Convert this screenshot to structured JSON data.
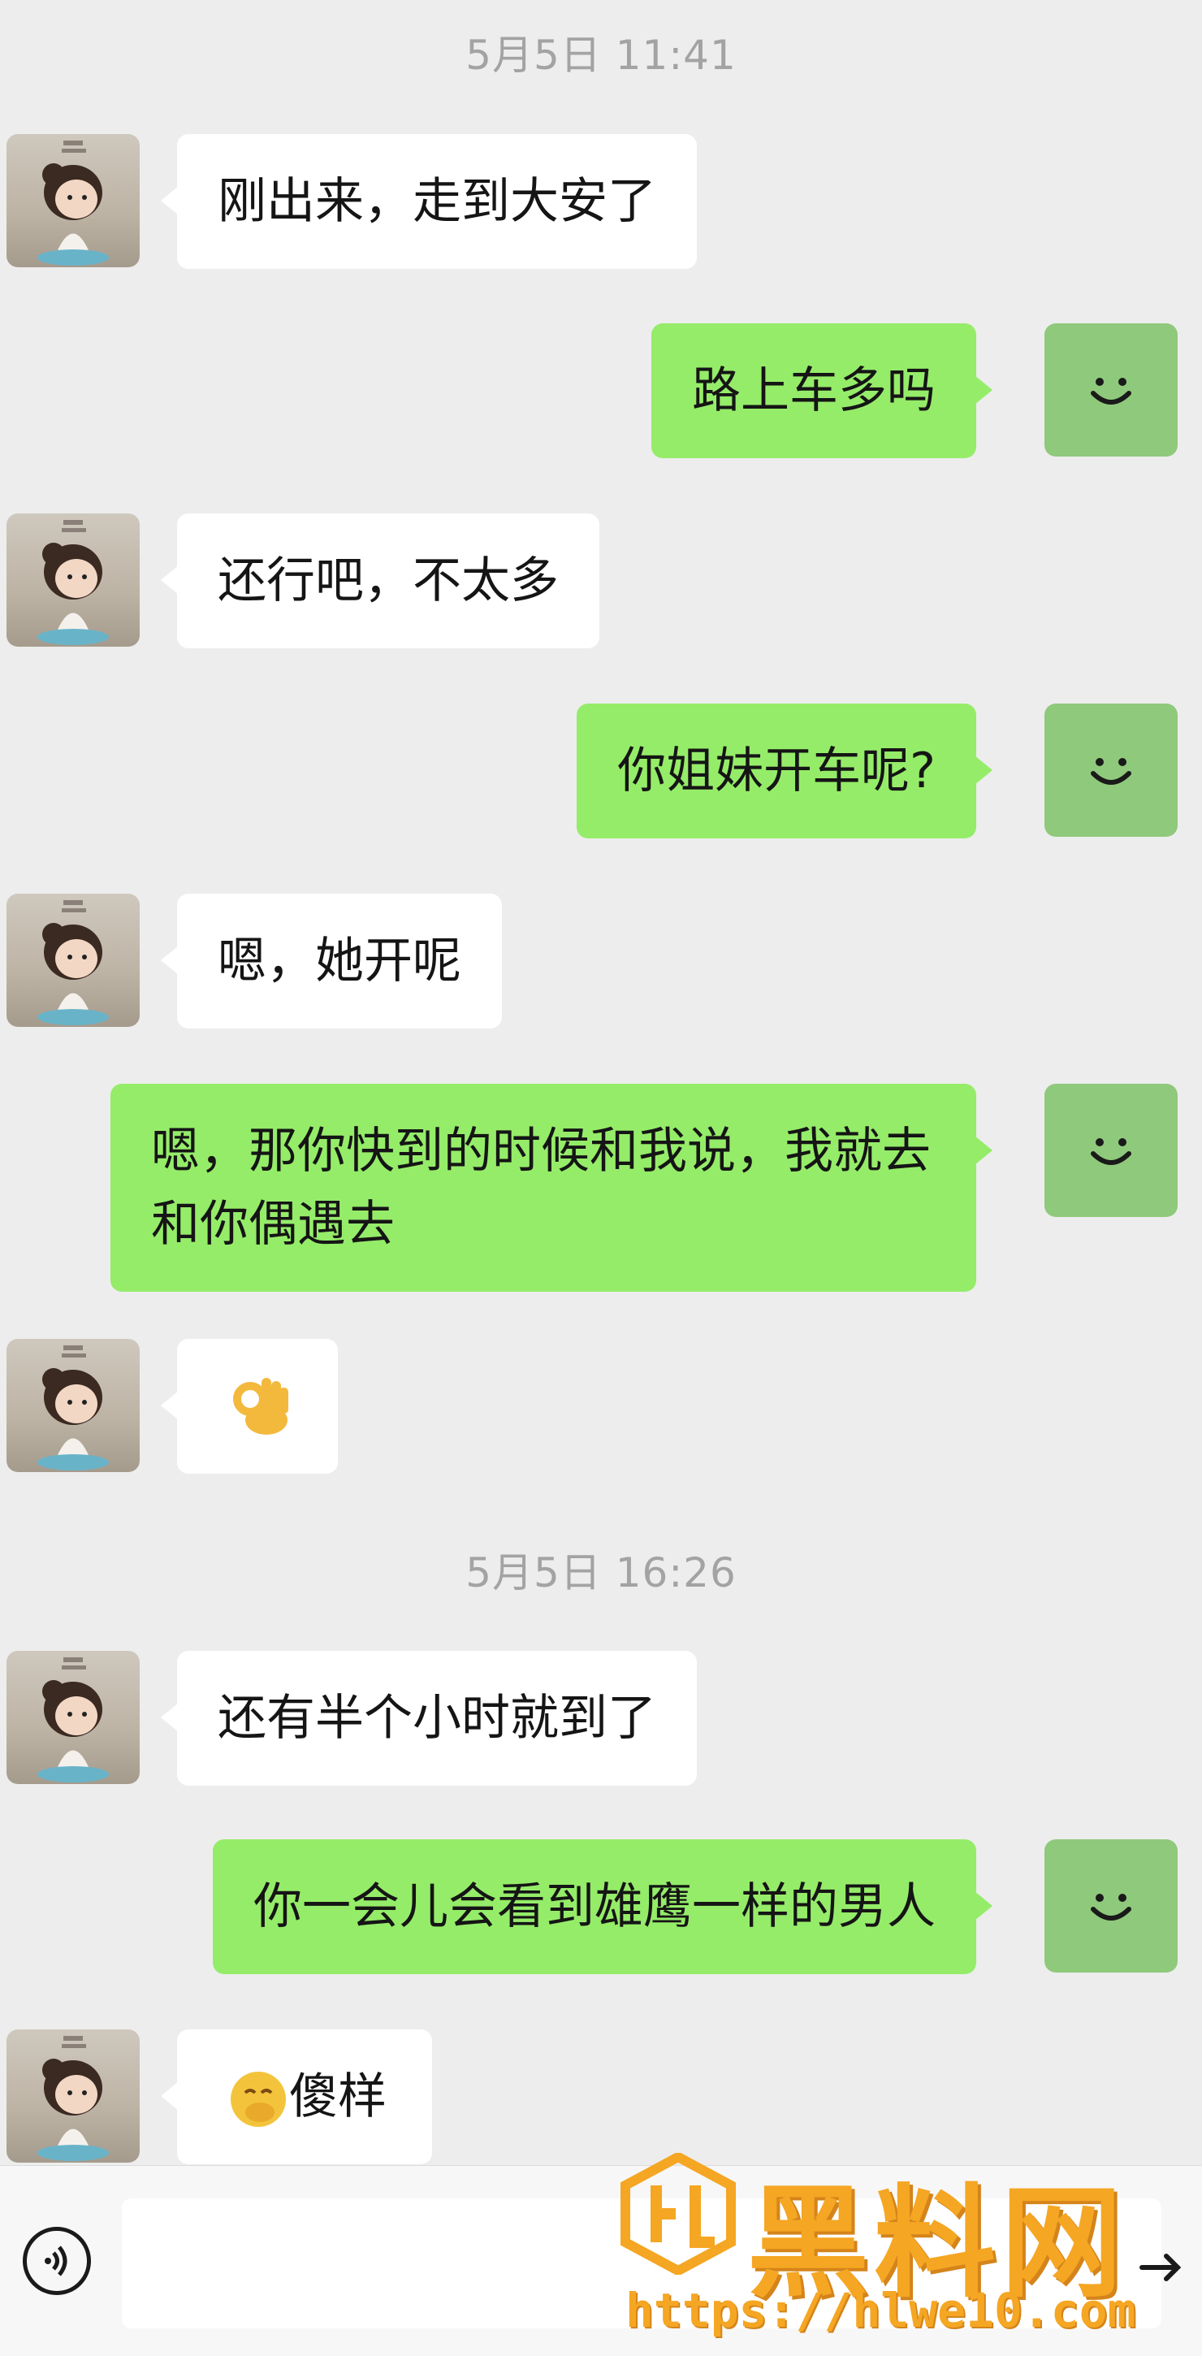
{
  "colors": {
    "background": "#ededed",
    "incoming_bubble": "#ffffff",
    "outgoing_bubble": "#95ec69",
    "timestamp_text": "#a3a3a3",
    "watermark": "#f5a623"
  },
  "timestamps": [
    "5月5日 11:41",
    "5月5日 16:26"
  ],
  "messages": [
    {
      "side": "in",
      "text": "刚出来，走到大安了"
    },
    {
      "side": "out",
      "text": "路上车多吗"
    },
    {
      "side": "in",
      "text": "还行吧，不太多"
    },
    {
      "side": "out",
      "text": "你姐妹开车呢?"
    },
    {
      "side": "in",
      "text": "嗯，她开呢"
    },
    {
      "side": "out",
      "text": "嗯，那你快到的时候和我说，我就去和你偶遇去"
    },
    {
      "side": "in",
      "emoji": "ok-hand-emoji",
      "text": ""
    },
    {
      "side": "in",
      "text": "还有半个小时就到了"
    },
    {
      "side": "out",
      "text": "你一会儿会看到雄鹰一样的男人"
    },
    {
      "side": "in",
      "emoji": "hand-over-mouth-emoji",
      "text": "傻样"
    }
  ],
  "icons": {
    "voice": "voice-icon",
    "send": "arrow-icon",
    "own_avatar": "smile-face-icon"
  },
  "watermark": {
    "title": "黑料网",
    "url": "https://hlwe10.com"
  }
}
